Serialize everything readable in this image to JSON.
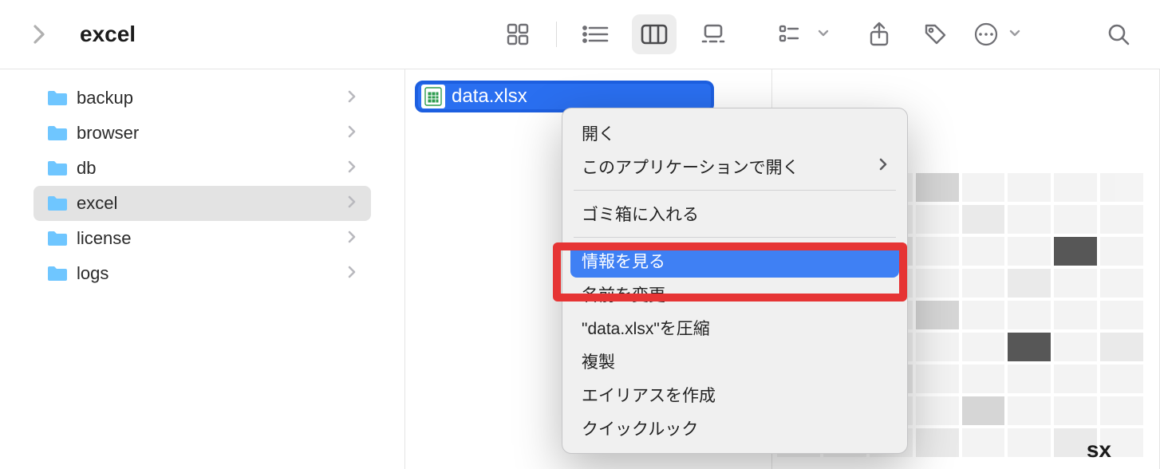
{
  "toolbar": {
    "title": "excel"
  },
  "sidebar": {
    "items": [
      {
        "name": "backup",
        "selected": false
      },
      {
        "name": "browser",
        "selected": false
      },
      {
        "name": "db",
        "selected": false
      },
      {
        "name": "excel",
        "selected": true
      },
      {
        "name": "license",
        "selected": false
      },
      {
        "name": "logs",
        "selected": false
      }
    ]
  },
  "file": {
    "name": "data.xlsx"
  },
  "context_menu": {
    "items": [
      {
        "label": "開く"
      },
      {
        "label": "このアプリケーションで開く",
        "submenu": true
      },
      {
        "sep": true
      },
      {
        "label": "ゴミ箱に入れる"
      },
      {
        "sep": true
      },
      {
        "label": "情報を見る",
        "highlight": true
      },
      {
        "label": "名前を変更"
      },
      {
        "label": "\"data.xlsx\"を圧縮"
      },
      {
        "label": "複製"
      },
      {
        "label": "エイリアスを作成"
      },
      {
        "label": "クイックルック"
      }
    ]
  },
  "preview": {
    "label_suffix": "sx"
  }
}
